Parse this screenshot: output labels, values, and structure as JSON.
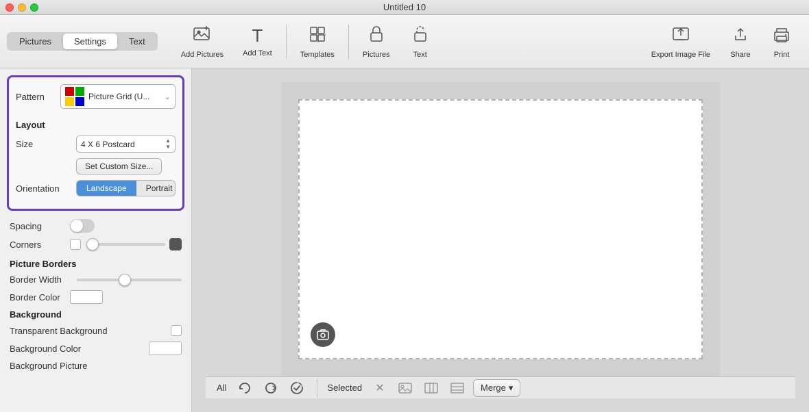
{
  "titlebar": {
    "title": "Untitled 10"
  },
  "toolbar": {
    "tabs": [
      {
        "id": "pictures",
        "label": "Pictures",
        "active": false
      },
      {
        "id": "settings",
        "label": "Settings",
        "active": true
      },
      {
        "id": "text",
        "label": "Text",
        "active": false
      }
    ],
    "add_pictures_label": "Add Pictures",
    "add_text_label": "Add Text",
    "templates_label": "Templates",
    "pictures_label": "Pictures",
    "text_label": "Text",
    "export_label": "Export Image File",
    "share_label": "Share",
    "print_label": "Print"
  },
  "sidebar": {
    "pattern_label": "Pattern",
    "pattern_name": "Picture Grid (U...",
    "layout_title": "Layout",
    "size_label": "Size",
    "size_value": "4 X 6 Postcard",
    "custom_size_label": "Set Custom Size...",
    "orientation_label": "Orientation",
    "landscape_label": "Landscape",
    "portrait_label": "Portrait",
    "spacing_label": "Spacing",
    "corners_label": "Corners",
    "picture_borders_title": "Picture Borders",
    "border_width_label": "Border Width",
    "border_color_label": "Border Color",
    "background_title": "Background",
    "transparent_bg_label": "Transparent Background",
    "bg_color_label": "Background Color",
    "bg_picture_label": "Background Picture"
  },
  "bottom_bar": {
    "all_label": "All",
    "selected_label": "Selected",
    "merge_label": "Merge",
    "merge_chevron": "▾"
  },
  "icons": {
    "add_pictures": "🖼",
    "add_text": "T",
    "templates": "⊞",
    "pictures_lock": "🔒",
    "text_lock": "🔓",
    "export": "⤴",
    "share": "⬆",
    "print": "🖨",
    "refresh1": "↺",
    "refresh2": "↻",
    "check_circle": "✓",
    "photo": "📷",
    "x_btn": "✕",
    "grid_icon": "⊞",
    "columns_icon": "⊟",
    "rows_icon": "⊠"
  }
}
